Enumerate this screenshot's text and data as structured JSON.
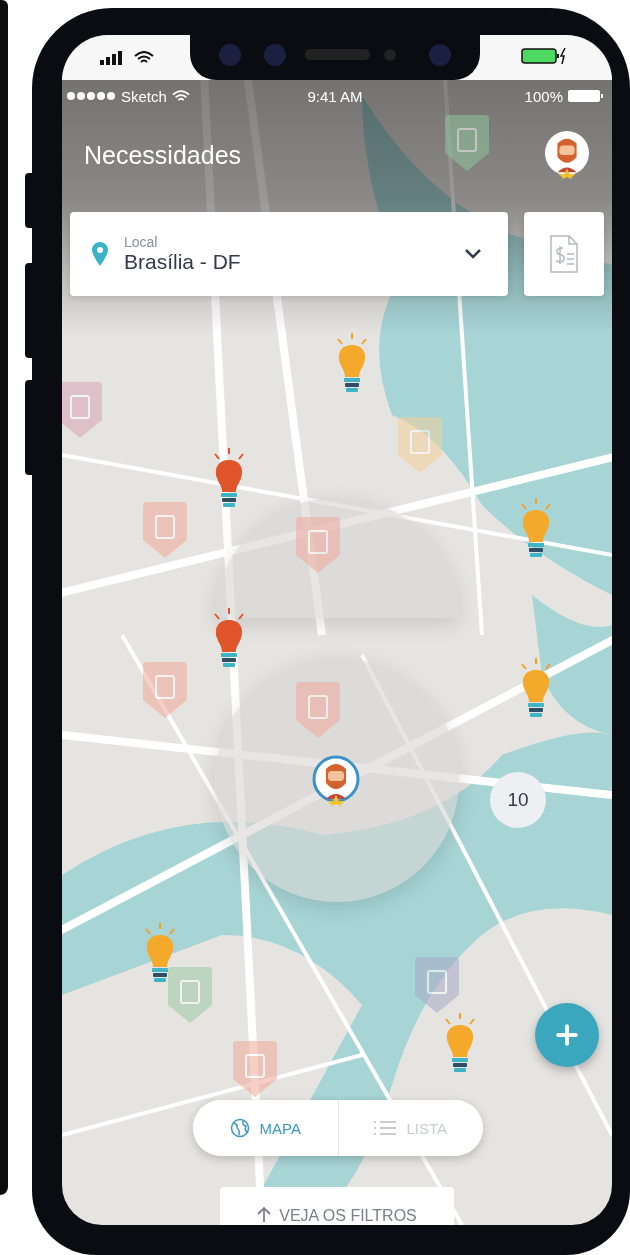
{
  "status_bar": {
    "carrier": "Sketch",
    "time": "9:41 AM",
    "battery": "100%"
  },
  "header": {
    "title": "Necessidades"
  },
  "location": {
    "label": "Local",
    "value": "Brasília - DF"
  },
  "map": {
    "kind": "picture",
    "cluster_count": "10"
  },
  "view_tabs": [
    {
      "label": "MAPA",
      "selected": true
    },
    {
      "label": "LISTA",
      "selected": false
    }
  ],
  "filters_button": "VEJA OS FILTROS"
}
